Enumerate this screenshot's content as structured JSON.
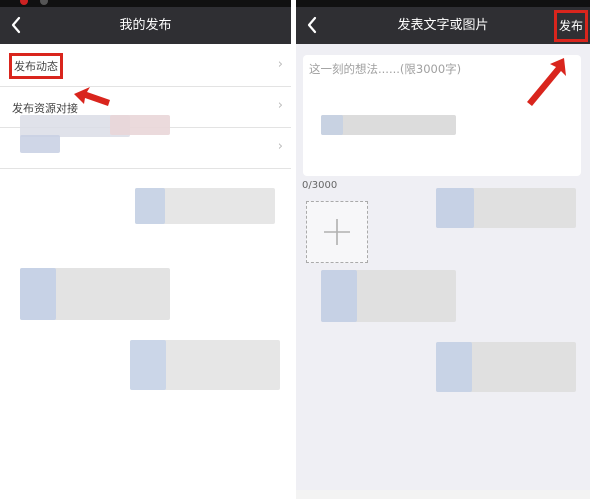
{
  "left": {
    "title": "我的发布",
    "items": [
      {
        "label": "发布动态"
      },
      {
        "label": "发布资源对接"
      },
      {
        "label": ""
      }
    ],
    "chevron": "›"
  },
  "right": {
    "title": "发表文字或图片",
    "publish_label": "发布",
    "textarea": {
      "placeholder": "这一刻的想法......(限3000字)",
      "value": ""
    },
    "counter": "0/3000"
  },
  "icons": {
    "back": "chevron-left-icon",
    "add": "plus-icon",
    "arrow": "red-arrow-annotation"
  },
  "colors": {
    "nav_bg": "#2f2f33",
    "highlight": "#d9251d",
    "right_bg": "#efeff4"
  }
}
